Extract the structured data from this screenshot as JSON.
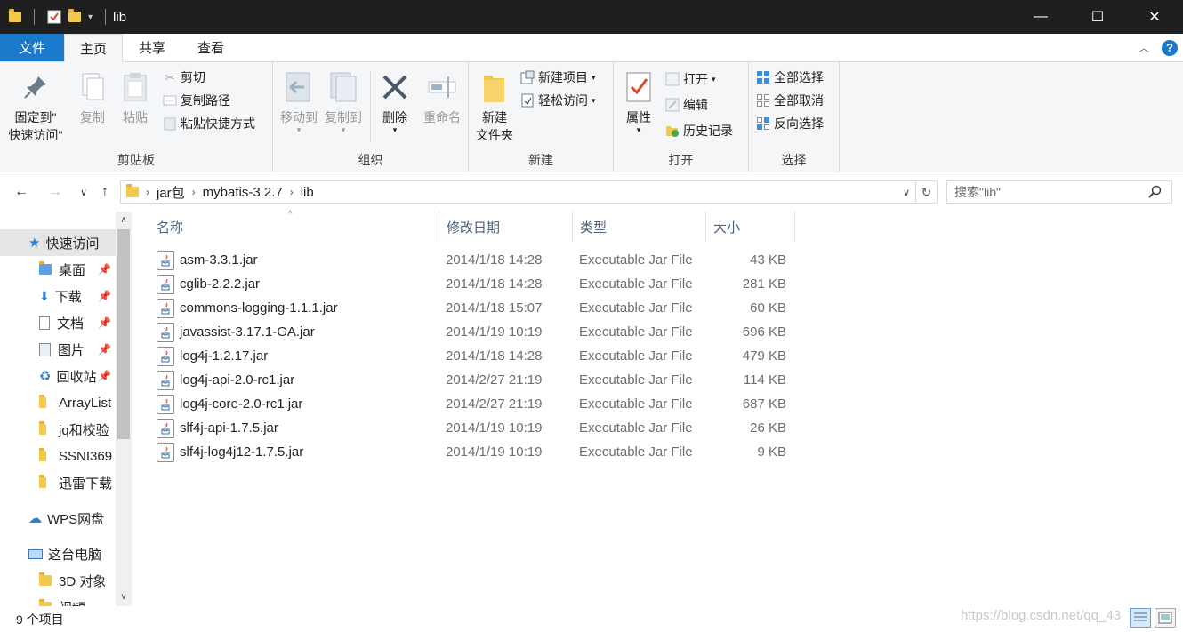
{
  "window": {
    "title": "lib",
    "minimize": "—",
    "maximize": "☐",
    "close": "✕"
  },
  "tabs": {
    "file": "文件",
    "home": "主页",
    "share": "共享",
    "view": "查看"
  },
  "ribbon": {
    "clipboard": {
      "group": "剪贴板",
      "pin_line1": "固定到\"",
      "pin_line2": "快速访问\"",
      "copy": "复制",
      "paste": "粘贴",
      "cut": "剪切",
      "copy_path": "复制路径",
      "paste_shortcut": "粘贴快捷方式"
    },
    "organize": {
      "group": "组织",
      "move_to": "移动到",
      "copy_to": "复制到",
      "delete": "删除",
      "rename": "重命名"
    },
    "new": {
      "group": "新建",
      "new_folder_line1": "新建",
      "new_folder_line2": "文件夹",
      "new_item": "新建项目",
      "easy_access": "轻松访问"
    },
    "open": {
      "group": "打开",
      "properties": "属性",
      "open": "打开",
      "edit": "编辑",
      "history": "历史记录"
    },
    "select": {
      "group": "选择",
      "select_all": "全部选择",
      "select_none": "全部取消",
      "invert": "反向选择"
    }
  },
  "address": {
    "crumbs": [
      "jar包",
      "mybatis-3.2.7",
      "lib"
    ],
    "search_placeholder": "搜索\"lib\""
  },
  "nav": {
    "quick_access": "快速访问",
    "desktop": "桌面",
    "downloads": "下载",
    "documents": "文档",
    "pictures": "图片",
    "recycle": "回收站",
    "arraylist": "ArrayList",
    "jq": "jq和校验",
    "ssni": "SSNI369",
    "xunlei": "迅雷下载",
    "wps": "WPS网盘",
    "this_pc": "这台电脑",
    "objects3d": "3D 对象",
    "videos": "视频"
  },
  "columns": {
    "name": "名称",
    "date": "修改日期",
    "type": "类型",
    "size": "大小"
  },
  "files": [
    {
      "name": "asm-3.3.1.jar",
      "date": "2014/1/18 14:28",
      "type": "Executable Jar File",
      "size": "43 KB"
    },
    {
      "name": "cglib-2.2.2.jar",
      "date": "2014/1/18 14:28",
      "type": "Executable Jar File",
      "size": "281 KB"
    },
    {
      "name": "commons-logging-1.1.1.jar",
      "date": "2014/1/18 15:07",
      "type": "Executable Jar File",
      "size": "60 KB"
    },
    {
      "name": "javassist-3.17.1-GA.jar",
      "date": "2014/1/19 10:19",
      "type": "Executable Jar File",
      "size": "696 KB"
    },
    {
      "name": "log4j-1.2.17.jar",
      "date": "2014/1/18 14:28",
      "type": "Executable Jar File",
      "size": "479 KB"
    },
    {
      "name": "log4j-api-2.0-rc1.jar",
      "date": "2014/2/27 21:19",
      "type": "Executable Jar File",
      "size": "114 KB"
    },
    {
      "name": "log4j-core-2.0-rc1.jar",
      "date": "2014/2/27 21:19",
      "type": "Executable Jar File",
      "size": "687 KB"
    },
    {
      "name": "slf4j-api-1.7.5.jar",
      "date": "2014/1/19 10:19",
      "type": "Executable Jar File",
      "size": "26 KB"
    },
    {
      "name": "slf4j-log4j12-1.7.5.jar",
      "date": "2014/1/19 10:19",
      "type": "Executable Jar File",
      "size": "9 KB"
    }
  ],
  "status": {
    "count": "9 个项目",
    "watermark": "https://blog.csdn.net/qq_43"
  }
}
